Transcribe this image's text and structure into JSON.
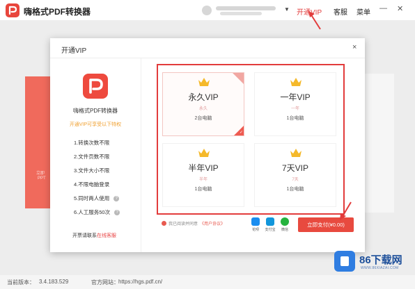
{
  "app": {
    "name": "嗨格式PDF转换器",
    "nav_vip": "开通VIP",
    "nav_service": "客服",
    "nav_menu": "菜单",
    "minimize_glyph": "—",
    "close_glyph": "✕",
    "dropdown_glyph": "▼"
  },
  "background": {
    "red_text_1": "立即",
    "red_text_2": "PPT"
  },
  "status": {
    "version_label": "当前版本：",
    "version": "3.4.183.529",
    "site_label": "官方网站：",
    "site": "https://hgs.pdf.cn/"
  },
  "dialog": {
    "title": "开通VIP",
    "close_glyph": "×",
    "sidebar": {
      "app_name": "嗨格式PDF转换器",
      "slogan": "开通VIP可享受以下特权",
      "features": [
        {
          "label": "1.转换次数不限",
          "help": false
        },
        {
          "label": "2.文件页数不限",
          "help": false
        },
        {
          "label": "3.文件大小不限",
          "help": false
        },
        {
          "label": "4.不限电脑登录",
          "help": false
        },
        {
          "label": "5.同时两人使用",
          "help": true
        },
        {
          "label": "6.人工服务50次",
          "help": true
        }
      ],
      "help_glyph": "?",
      "footer_text": "开票请联系",
      "footer_link": "在线客服"
    },
    "plans": [
      {
        "name": "永久VIP",
        "sub": "永久",
        "devices": "2台电脑",
        "selected": true
      },
      {
        "name": "一年VIP",
        "sub": "一年",
        "devices": "1台电脑",
        "selected": false
      },
      {
        "name": "半年VIP",
        "sub": "半年",
        "devices": "1台电脑",
        "selected": false
      },
      {
        "name": "7天VIP",
        "sub": "7天",
        "devices": "1台电脑",
        "selected": false
      }
    ],
    "agree_text": "我已阅读并同意",
    "agree_link": "《用户协议》",
    "payment_methods": [
      {
        "label": "花呗",
        "color": "#1a8df0"
      },
      {
        "label": "支付宝",
        "color": "#1296db"
      },
      {
        "label": "微信",
        "color": "#25b33e"
      }
    ],
    "pay_button": "立即支付(¥0.00)",
    "check_glyph": "✓"
  },
  "watermark": {
    "title": "86下载网",
    "subtitle": "WWW.86XIAZAI.COM"
  },
  "colors": {
    "accent": "#e23b3b",
    "gold": "#f5b92a"
  }
}
